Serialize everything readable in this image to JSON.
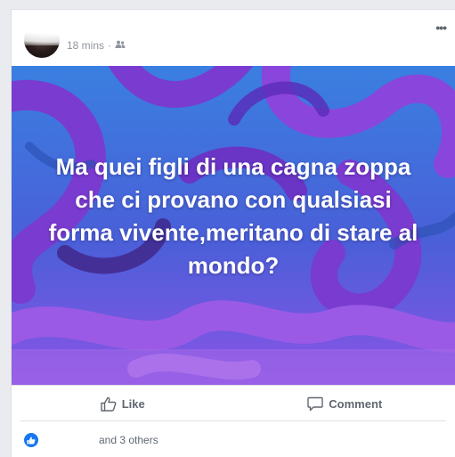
{
  "post": {
    "author_partial": "ı̇́ ̣̣  ̣̣̣",
    "time": "18 mins",
    "meta_separator": "·",
    "audience_icon": "friends-icon",
    "more_icon": "more-options-icon"
  },
  "image": {
    "caption": "Ma quei figli di una cagna zoppa che ci provano con qualsiasi forma vivente,meritano di stare al mondo?",
    "colors": {
      "blue": "#2f79d6",
      "purple": "#7a3bd0",
      "violet_light": "#a66ae8",
      "dark": "#3d1d7a"
    }
  },
  "actions": {
    "like_label": "Like",
    "comment_label": "Comment"
  },
  "reactions": {
    "icon": "like-reaction-icon",
    "others_text": "and 3 others"
  },
  "colors": {
    "facebook_blue": "#1877f2",
    "text_secondary": "#606770",
    "border": "#dddfe2"
  }
}
